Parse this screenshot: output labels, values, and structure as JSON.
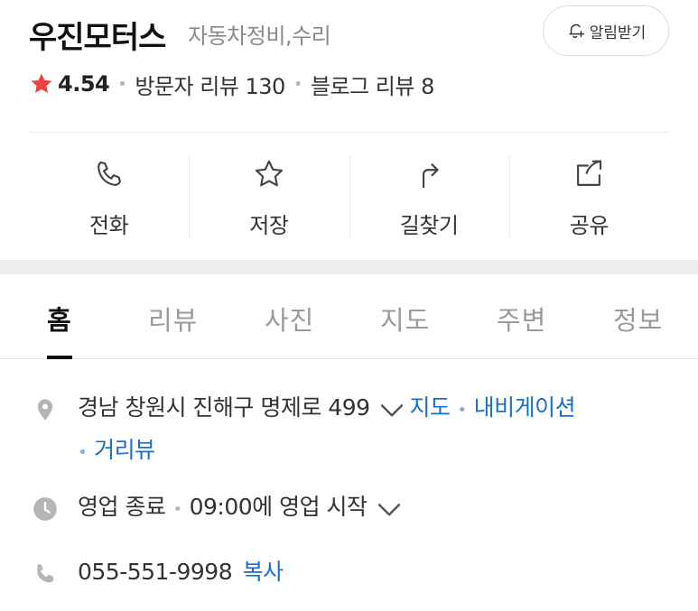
{
  "place": {
    "name": "우진모터스",
    "category": "자동차정비,수리",
    "alarm_label": "알림받기"
  },
  "rating": {
    "score": "4.54",
    "visitor_reviews": "방문자 리뷰 130",
    "blog_reviews": "블로그 리뷰 8"
  },
  "actions": [
    {
      "label": "전화",
      "icon": "phone-icon"
    },
    {
      "label": "저장",
      "icon": "star-outline-icon"
    },
    {
      "label": "길찾기",
      "icon": "directions-icon"
    },
    {
      "label": "공유",
      "icon": "share-icon"
    }
  ],
  "tabs": [
    {
      "label": "홈",
      "active": true
    },
    {
      "label": "리뷰"
    },
    {
      "label": "사진"
    },
    {
      "label": "지도"
    },
    {
      "label": "주변"
    },
    {
      "label": "정보"
    }
  ],
  "info": {
    "address": "경남 창원시 진해구 명제로 499",
    "map_link": "지도",
    "navigation_link": "내비게이션",
    "street_view_link": "거리뷰",
    "hours_status": "영업 종료",
    "hours_next": "09:00에 영업 시작",
    "phone": "055-551-9998",
    "copy_label": "복사"
  },
  "colors": {
    "accent_link": "#1a6fc8",
    "star": "#f04141",
    "muted": "#8a8a8a"
  }
}
